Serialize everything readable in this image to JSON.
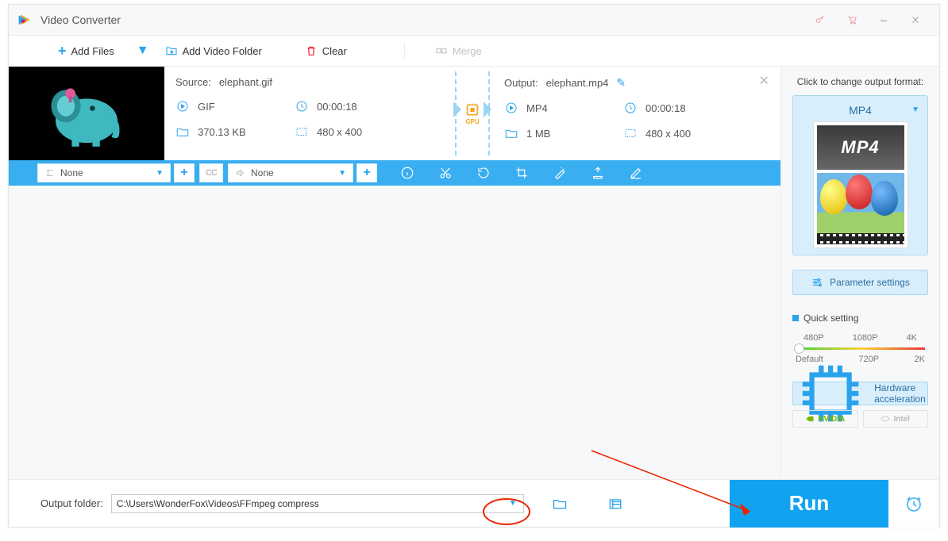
{
  "title": "Video Converter",
  "toolbar": {
    "add_files": "Add Files",
    "add_folder": "Add Video Folder",
    "clear": "Clear",
    "merge": "Merge"
  },
  "file": {
    "source_label": "Source:",
    "source_name": "elephant.gif",
    "output_label": "Output:",
    "output_name": "elephant.mp4",
    "src_format": "GIF",
    "src_duration": "00:00:18",
    "src_size": "370.13 KB",
    "src_res": "480 x 400",
    "out_format": "MP4",
    "out_duration": "00:00:18",
    "out_size": "1 MB",
    "out_res": "480 x 400",
    "gpu": "GPU",
    "subtitle": "None",
    "audio": "None",
    "cc": "CC"
  },
  "right": {
    "title": "Click to change output format:",
    "format": "MP4",
    "badge": "MP4",
    "param": "Parameter settings",
    "quick": "Quick setting",
    "ticks_top": [
      "480P",
      "1080P",
      "4K"
    ],
    "ticks_bot": [
      "Default",
      "720P",
      "2K"
    ],
    "hw": "Hardware acceleration",
    "nvidia": "NVIDIA",
    "intel": "Intel"
  },
  "bottom": {
    "label": "Output folder:",
    "path": "C:\\Users\\WonderFox\\Videos\\FFmpeg compress",
    "run": "Run"
  }
}
